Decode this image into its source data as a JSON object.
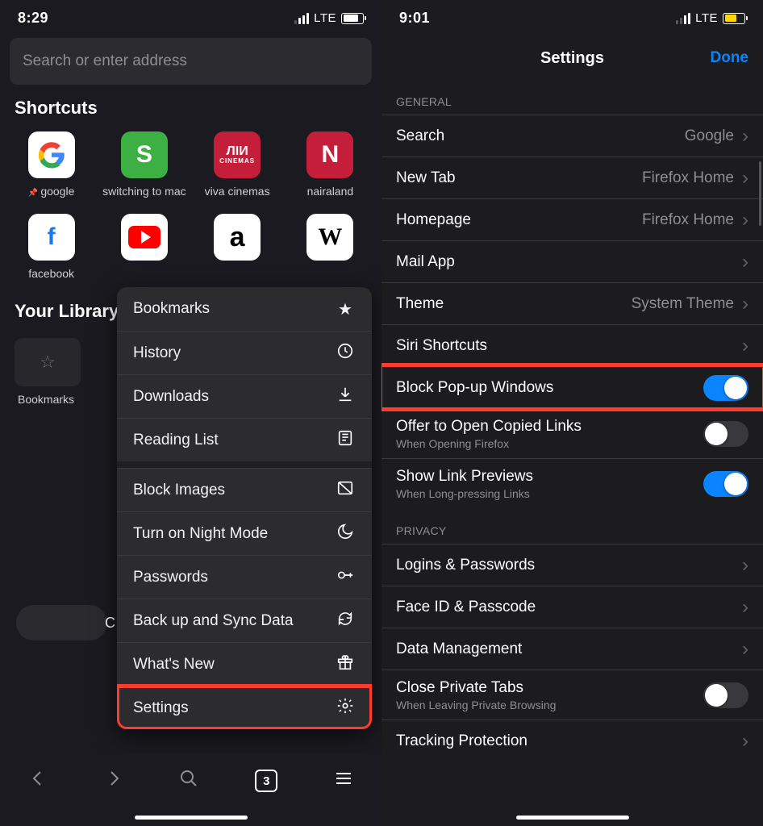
{
  "left": {
    "status": {
      "time": "8:29",
      "network": "LTE"
    },
    "search_placeholder": "Search or enter address",
    "shortcuts_header": "Shortcuts",
    "shortcuts": [
      {
        "label": "google",
        "pinned": true
      },
      {
        "label": "switching to mac"
      },
      {
        "label": "viva cinemas"
      },
      {
        "label": "nairaland"
      },
      {
        "label": "facebook"
      },
      {
        "label": ""
      },
      {
        "label": ""
      },
      {
        "label": ""
      }
    ],
    "library_header": "Your Library",
    "library_label": "Bookmarks",
    "menu": [
      {
        "label": "Bookmarks",
        "icon": "star-filled"
      },
      {
        "label": "History",
        "icon": "clock"
      },
      {
        "label": "Downloads",
        "icon": "download"
      },
      {
        "label": "Reading List",
        "icon": "book"
      }
    ],
    "menu2": [
      {
        "label": "Block Images",
        "icon": "no-image"
      },
      {
        "label": "Turn on Night Mode",
        "icon": "moon"
      },
      {
        "label": "Passwords",
        "icon": "key"
      },
      {
        "label": "Back up and Sync Data",
        "icon": "sync"
      },
      {
        "label": "What's New",
        "icon": "gift"
      },
      {
        "label": "Settings",
        "icon": "gear",
        "highlight": true
      }
    ],
    "tab_count": "3"
  },
  "right": {
    "status": {
      "time": "9:01",
      "network": "LTE"
    },
    "nav_title": "Settings",
    "nav_done": "Done",
    "sections": {
      "general": {
        "header": "GENERAL",
        "rows": [
          {
            "label": "Search",
            "value": "Google",
            "type": "nav"
          },
          {
            "label": "New Tab",
            "value": "Firefox Home",
            "type": "nav"
          },
          {
            "label": "Homepage",
            "value": "Firefox Home",
            "type": "nav"
          },
          {
            "label": "Mail App",
            "type": "nav"
          },
          {
            "label": "Theme",
            "value": "System Theme",
            "type": "nav"
          },
          {
            "label": "Siri Shortcuts",
            "type": "nav"
          },
          {
            "label": "Block Pop-up Windows",
            "type": "toggle",
            "on": true,
            "highlight": true
          },
          {
            "label": "Offer to Open Copied Links",
            "sub": "When Opening Firefox",
            "type": "toggle",
            "on": false
          },
          {
            "label": "Show Link Previews",
            "sub": "When Long-pressing Links",
            "type": "toggle",
            "on": true
          }
        ]
      },
      "privacy": {
        "header": "PRIVACY",
        "rows": [
          {
            "label": "Logins & Passwords",
            "type": "nav"
          },
          {
            "label": "Face ID & Passcode",
            "type": "nav"
          },
          {
            "label": "Data Management",
            "type": "nav"
          },
          {
            "label": "Close Private Tabs",
            "sub": "When Leaving Private Browsing",
            "type": "toggle",
            "on": false
          },
          {
            "label": "Tracking Protection",
            "type": "nav"
          }
        ]
      }
    }
  }
}
